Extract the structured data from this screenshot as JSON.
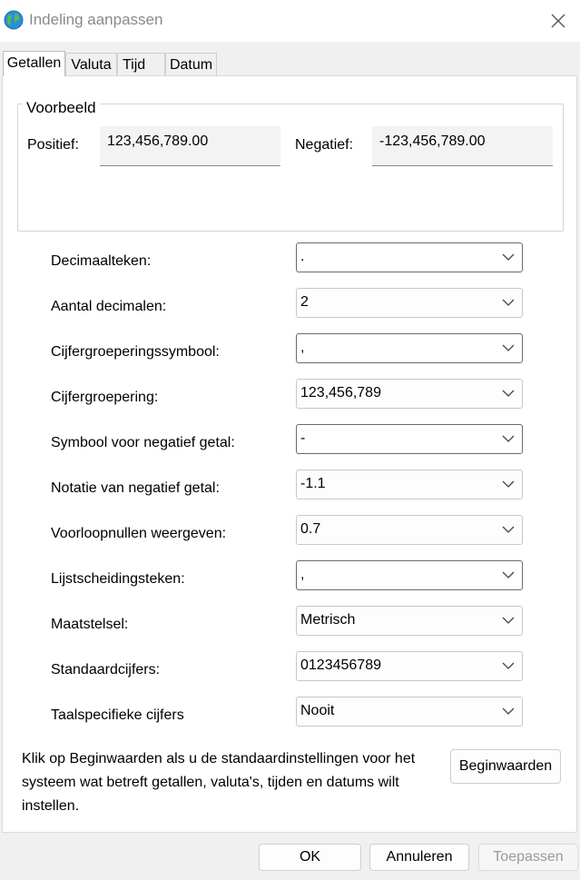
{
  "window": {
    "title": "Indeling aanpassen",
    "app_icon": "globe-icon",
    "close_icon": "close-icon"
  },
  "tabs": [
    {
      "label": "Getallen",
      "active": true
    },
    {
      "label": "Valuta",
      "active": false
    },
    {
      "label": "Tijd",
      "active": false
    },
    {
      "label": "Datum",
      "active": false
    }
  ],
  "preview": {
    "title": "Voorbeeld",
    "positive_label": "Positief:",
    "positive_value": "123,456,789.00",
    "negative_label": "Negatief:",
    "negative_value": "-123,456,789.00"
  },
  "settings": [
    {
      "label": "Decimaalteken:",
      "value": "."
    },
    {
      "label": "Aantal decimalen:",
      "value": "2"
    },
    {
      "label": "Cijfergroeperingssymbool:",
      "value": ","
    },
    {
      "label": "Cijfergroepering:",
      "value": "123,456,789"
    },
    {
      "label": "Symbool voor negatief getal:",
      "value": "-"
    },
    {
      "label": "Notatie van negatief getal:",
      "value": "-1.1"
    },
    {
      "label": "Voorloopnullen weergeven:",
      "value": "0.7"
    },
    {
      "label": "Lijstscheidingsteken:",
      "value": ","
    },
    {
      "label": "Maatstelsel:",
      "value": "Metrisch"
    },
    {
      "label": "Standaardcijfers:",
      "value": "0123456789"
    },
    {
      "label": "Taalspecifieke cijfers",
      "value": "Nooit"
    }
  ],
  "reset": {
    "info_text": "Klik op Beginwaarden als u de standaardinstellingen voor het systeem wat betreft getallen, valuta's, tijden en datums wilt instellen.",
    "button_label": "Beginwaarden"
  },
  "footer": {
    "ok_label": "OK",
    "cancel_label": "Annuleren",
    "apply_label": "Toepassen"
  }
}
